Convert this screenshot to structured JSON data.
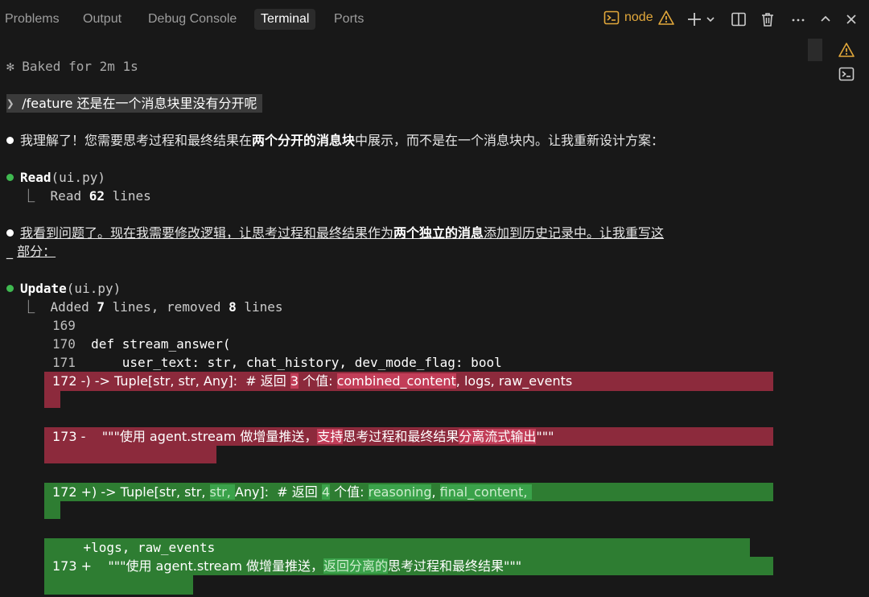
{
  "panel": {
    "tabs": [
      "Problems",
      "Output",
      "Debug Console",
      "Terminal",
      "Ports"
    ],
    "active_tab": "Terminal",
    "terminal_name": "node",
    "icons": [
      "terminal-icon",
      "warning-icon",
      "add-icon",
      "chevron-down-icon",
      "split-icon",
      "trash-icon",
      "more-icon",
      "maximize-icon",
      "close-icon"
    ]
  },
  "side": {
    "icons": [
      "warning-icon",
      "terminal-icon"
    ]
  },
  "colors": {
    "deleted_bg": "#8c2a3c",
    "deleted_highlight": "#c23d58",
    "added_bg": "#2e7d32",
    "added_highlight": "#3aa24a",
    "accent": "#e2a83b",
    "bullet_green": "#3fb950"
  },
  "terminal": {
    "baked": "✻ Baked for 2m 1s",
    "prompt": "/feature 还是在一个消息块里没有分开呢",
    "msg1_a": "我理解了！您需要思考过程和最终结果在",
    "msg1_b": "两个分开的消息块",
    "msg1_c": "中展示，而不是在一个消息块内。让我重新设计方案：",
    "read_tool": "Read",
    "read_arg": "(ui.py)",
    "read_result_a": "Read ",
    "read_result_b": "62",
    "read_result_c": " lines",
    "msg2_a": "我看到问题了。现在我需要修改逻辑，让思考过程和最终结果作为",
    "msg2_b": "两个独立的消息",
    "msg2_c": "添加到历史记录中。让我重写这",
    "msg2_d": "部分：",
    "update_tool": "Update",
    "update_arg": "(ui.py)",
    "update_result_a": "Added ",
    "update_result_b": "7",
    "update_result_c": " lines, removed ",
    "update_result_d": "8",
    "update_result_e": " lines",
    "ctx": [
      {
        "num": "169",
        "text": ""
      },
      {
        "num": "170",
        "text": "def stream_answer("
      },
      {
        "num": "171",
        "text": "    user_text: str, chat_history, dev_mode_flag: bool"
      }
    ],
    "del172": {
      "prefix": "172 -) -> Tuple[str, str, Any]:  # 返回 ",
      "h1": "3",
      "mid": " 个值: ",
      "h2": "combined_content",
      "rest": ", logs, raw_events"
    },
    "del173": {
      "prefix": "173 -    \"\"\"使用 agent.stream 做增量推送，",
      "h1": "支持",
      "mid": "思考过程和最终结果",
      "h2": "分离流式输出",
      "rest": "\"\"\""
    },
    "add172": {
      "prefix": "172 +) -> Tuple[str, str, ",
      "h1": "str, ",
      "mid": "Any]:  # 返回 ",
      "h2": "4",
      "mid2": " 个值: ",
      "h3": "reasoning",
      "mid3": ", ",
      "h4": "final_content, "
    },
    "add172b": "    +logs, raw_events",
    "add173": {
      "prefix": "173 +    \"\"\"使用 agent.stream 做增量推送，",
      "h1": "返回分离的",
      "rest": "思考过程和最终结果\"\"\""
    }
  }
}
